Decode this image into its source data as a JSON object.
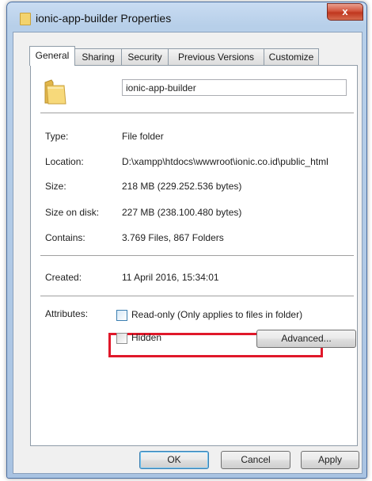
{
  "window": {
    "title": "ionic-app-builder Properties",
    "close_glyph": "x"
  },
  "tabs": [
    {
      "label": "General",
      "active": true
    },
    {
      "label": "Sharing",
      "active": false
    },
    {
      "label": "Security",
      "active": false
    },
    {
      "label": "Previous Versions",
      "active": false
    },
    {
      "label": "Customize",
      "active": false
    }
  ],
  "general": {
    "folder_name": "ionic-app-builder",
    "properties": [
      {
        "label": "Type:",
        "value": "File folder"
      },
      {
        "label": "Location:",
        "value": "D:\\xampp\\htdocs\\wwwroot\\ionic.co.id\\public_html"
      },
      {
        "label": "Size:",
        "value": "218 MB (229.252.536 bytes)"
      },
      {
        "label": "Size on disk:",
        "value": "227 MB (238.100.480 bytes)"
      },
      {
        "label": "Contains:",
        "value": "3.769 Files, 867 Folders"
      }
    ],
    "created": {
      "label": "Created:",
      "value": "11 April 2016, 15:34:01"
    },
    "attributes": {
      "label": "Attributes:",
      "readonly_label": "Read-only (Only applies to files in folder)",
      "readonly_checked": false,
      "hidden_label": "Hidden",
      "hidden_checked": false,
      "advanced_label": "Advanced..."
    }
  },
  "buttons": {
    "ok": "OK",
    "cancel": "Cancel",
    "apply": "Apply"
  },
  "icons": {
    "folder": "folder-icon",
    "close": "close-icon"
  },
  "colors": {
    "highlight": "#e0182a",
    "title_bar": "#b7cfe9",
    "close_button": "#c0361e"
  }
}
